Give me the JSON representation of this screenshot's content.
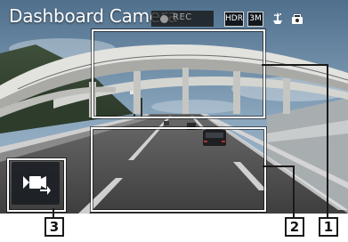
{
  "screen": {
    "title": "Dashboard Camera",
    "rec_label": "REC",
    "badges": [
      "HDR",
      "3M"
    ],
    "icons": [
      "quality-icon",
      "car-camera-icon"
    ],
    "playback_button_icon": "video-playback-icon"
  },
  "callouts": [
    "1",
    "2",
    "3"
  ],
  "colors": {
    "sky": "#6f8ea8",
    "road": "#4f4f4f",
    "bridge": "#d8d8d4",
    "callout_border": "#ffffff",
    "label_border": "#1a1a1a"
  }
}
